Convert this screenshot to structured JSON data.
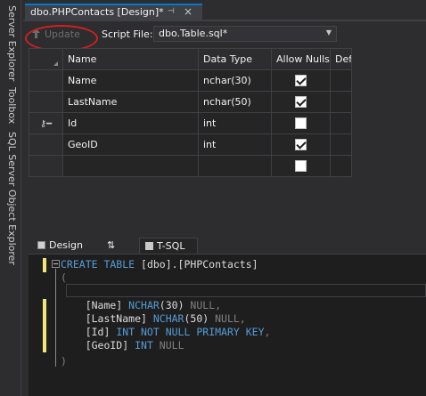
{
  "side_panels": [
    "Server Explorer",
    "Toolbox",
    "SQL Server Object Explorer"
  ],
  "document_tab": {
    "title": "dbo.PHPContacts [Design]*",
    "pin": "⊣",
    "close": "×"
  },
  "toolbar": {
    "update_label": "Update",
    "script_file_label": "Script File:",
    "script_file_value": "dbo.Table.sql*"
  },
  "grid": {
    "headers": [
      "Name",
      "Data Type",
      "Allow Nulls",
      "Default"
    ],
    "rows": [
      {
        "name": "Name",
        "type": "nchar(30)",
        "allow_nulls": true,
        "key": false,
        "default": ""
      },
      {
        "name": "LastName",
        "type": "nchar(50)",
        "allow_nulls": true,
        "key": false,
        "default": ""
      },
      {
        "name": "Id",
        "type": "int",
        "allow_nulls": false,
        "key": true,
        "default": ""
      },
      {
        "name": "GeoID",
        "type": "int",
        "allow_nulls": true,
        "key": false,
        "default": ""
      },
      {
        "name": "",
        "type": "",
        "allow_nulls": false,
        "key": false,
        "default": ""
      }
    ]
  },
  "pane_tabs": {
    "design": "Design",
    "swap": "⇅",
    "tsql": "T-SQL"
  },
  "sql_lines": [
    [
      "CREATE TABLE ",
      "[dbo]",
      ".",
      "[PHPContacts]"
    ],
    "(",
    "    [Name] ",
    "    [LastName] ",
    "    [Id] ",
    "    [GeoID] ",
    ")"
  ],
  "sql": {
    "line1_kw": "CREATE TABLE",
    "line1_rest": " [dbo].[PHPContacts]",
    "open": "(",
    "name_col": "    [Name] ",
    "name_type": "NCHAR",
    "name_len": "(30) ",
    "name_null": "NULL,",
    "last_col": "    [LastName] ",
    "last_type": "NCHAR",
    "last_len": "(50) ",
    "last_null": "NULL,",
    "id_col": "    [Id] ",
    "id_type": "INT NOT NULL",
    "id_pk": "PRIMARY KEY",
    "id_end": ",",
    "geo_col": "    [GeoID] ",
    "geo_type": "INT",
    "geo_null": " NULL",
    "close": ")"
  },
  "colors": {
    "accent": "#007acc",
    "keyword": "#569cd6",
    "highlight": "#d21f1f",
    "change_bar": "#efe67a"
  },
  "icons": [
    "up-arrow-icon",
    "key-icon",
    "design-icon",
    "swap-icon",
    "tsql-icon",
    "dropdown-icon",
    "pin-icon",
    "close-icon"
  ]
}
